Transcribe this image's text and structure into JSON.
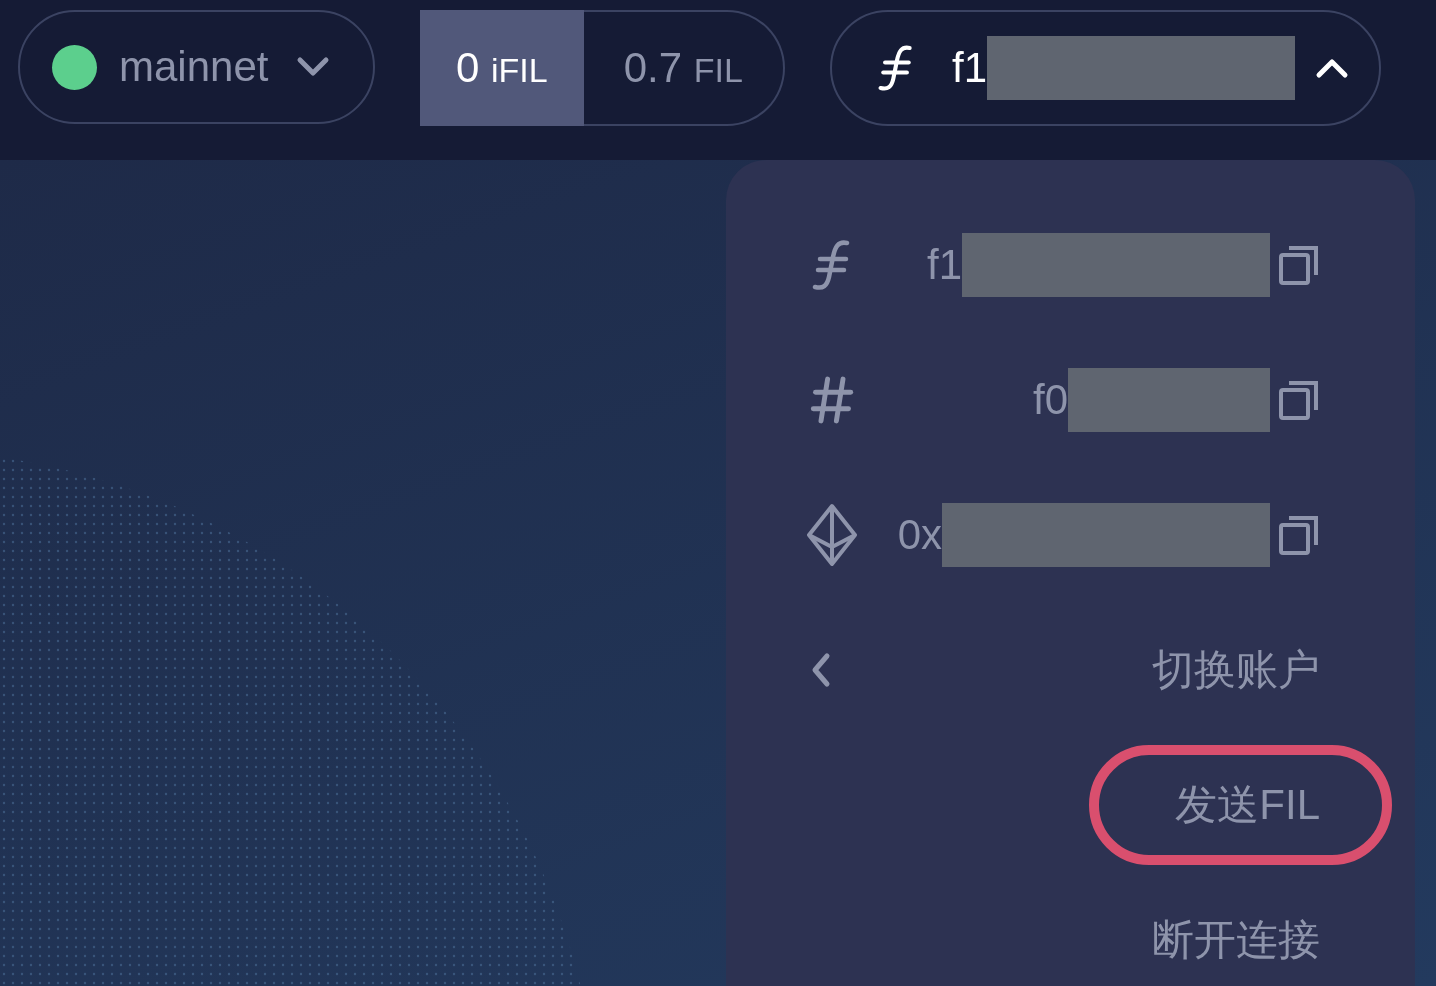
{
  "network": {
    "name": "mainnet",
    "connected": true
  },
  "balances": [
    {
      "amount": "0",
      "unit": "iFIL",
      "selected": true
    },
    {
      "amount": "0.7",
      "unit": "FIL",
      "selected": false
    }
  ],
  "account": {
    "address": "f1",
    "expanded": true
  },
  "menu": {
    "addresses": [
      {
        "kind": "filecoin",
        "text": "f1"
      },
      {
        "kind": "id",
        "text": "f0"
      },
      {
        "kind": "ethereum",
        "text": "0x"
      }
    ],
    "actions": [
      {
        "kind": "back",
        "label": "切换账户",
        "highlighted": false
      },
      {
        "kind": "plain",
        "label": "发送FIL",
        "highlighted": true
      },
      {
        "kind": "plain",
        "label": "断开连接",
        "highlighted": false
      }
    ]
  }
}
